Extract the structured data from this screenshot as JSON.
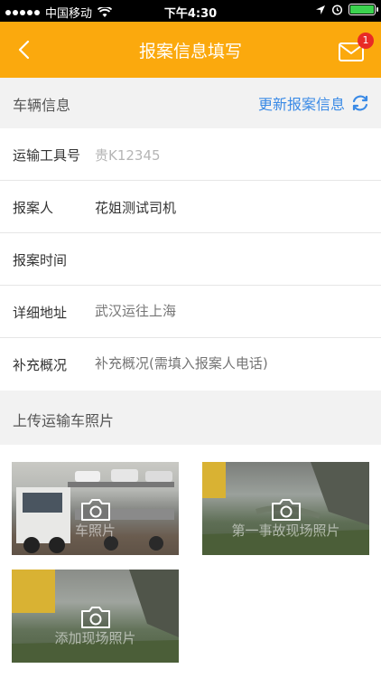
{
  "status_bar": {
    "carrier": "中国移动",
    "time": "下午4:30"
  },
  "nav": {
    "title": "报案信息填写",
    "badge_count": "1"
  },
  "vehicle_section": {
    "title": "车辆信息",
    "update_label": "更新报案信息"
  },
  "form": {
    "transport_no_label": "运输工具号",
    "transport_no_value": "贵K12345",
    "reporter_label": "报案人",
    "reporter_value": "花姐测试司机",
    "report_time_label": "报案时间",
    "report_time_value": "",
    "address_label": "详细地址",
    "address_placeholder": "武汉运往上海",
    "supplement_label": "补充概况",
    "supplement_placeholder": "补充概况(需填入报案人电话)"
  },
  "upload_section": {
    "title": "上传运输车照片"
  },
  "photos": [
    {
      "caption": "车照片"
    },
    {
      "caption": "第一事故现场照片"
    },
    {
      "caption": "添加现场照片"
    }
  ]
}
